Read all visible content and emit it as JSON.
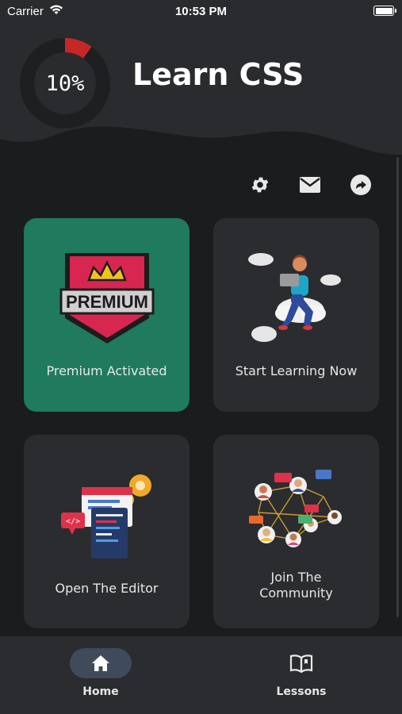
{
  "status": {
    "carrier": "Carrier",
    "time": "10:53 PM"
  },
  "header": {
    "title": "Learn CSS",
    "progress_text": "10%",
    "progress_fraction": 0.1
  },
  "toolbar": {
    "settings_icon": "gear-icon",
    "mail_icon": "mail-icon",
    "share_icon": "share-icon"
  },
  "cards": {
    "premium": {
      "label": "Premium Activated",
      "badge_text": "PREMIUM"
    },
    "learning": {
      "label": "Start Learning Now"
    },
    "editor": {
      "label": "Open The Editor"
    },
    "community": {
      "label_line1": "Join The",
      "label_line2": "Community"
    }
  },
  "nav": {
    "home": {
      "label": "Home",
      "icon": "home-icon"
    },
    "lessons": {
      "label": "Lessons",
      "icon": "book-icon"
    }
  },
  "colors": {
    "background": "#1b1c1e",
    "header": "#2a2b2e",
    "card": "#2b2c2f",
    "premium_card": "#1f7a5e",
    "progress": "#c62828",
    "nav_pill": "#3f4a5a"
  }
}
